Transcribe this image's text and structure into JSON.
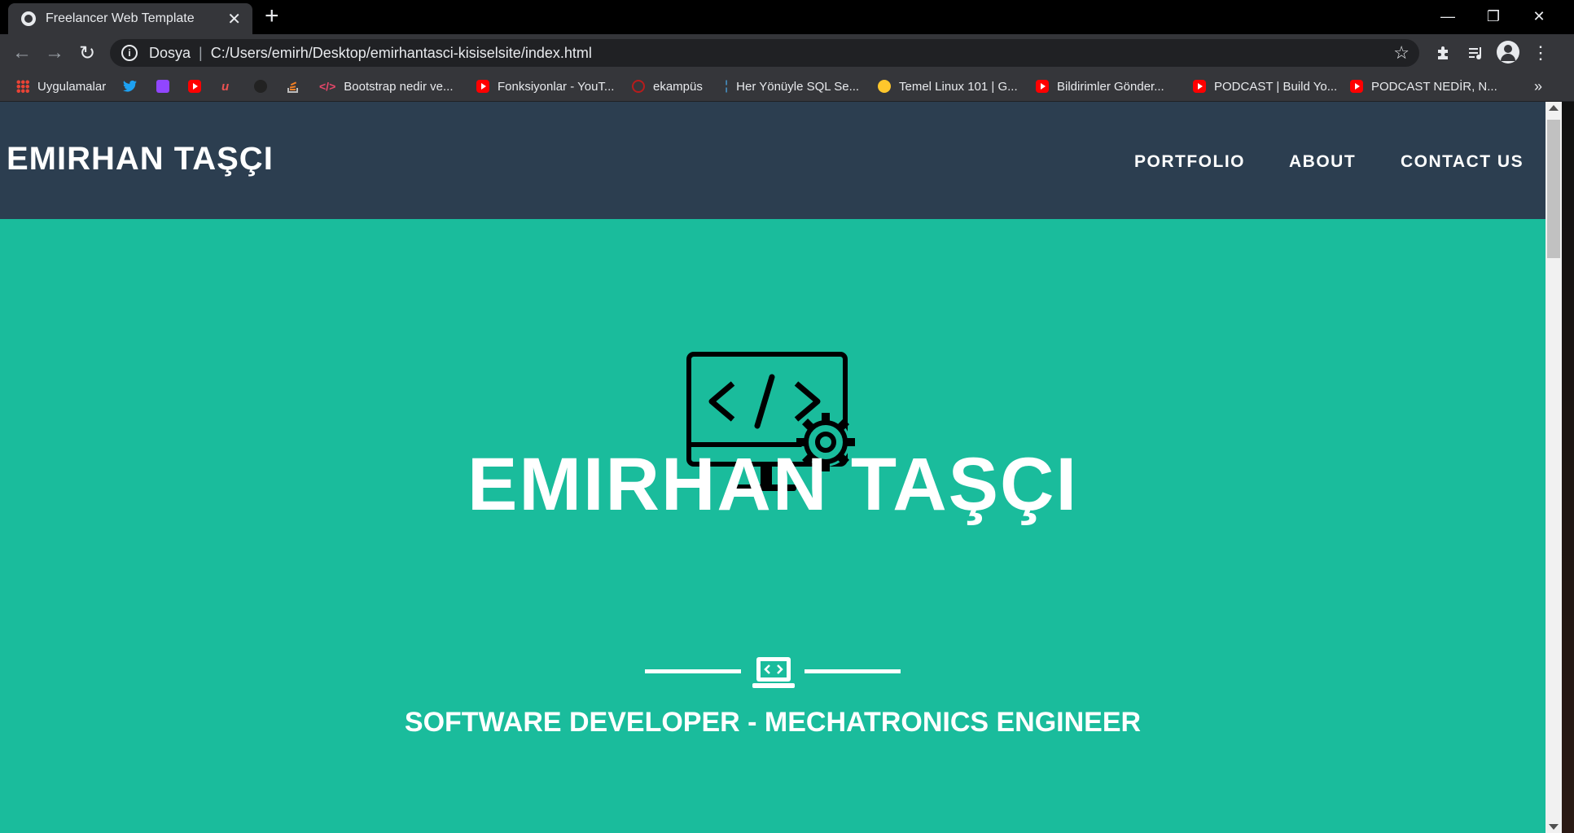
{
  "browser": {
    "tab_title": "Freelancer Web Template",
    "new_tab": "+",
    "window_controls": {
      "minimize": "—",
      "restore": "❐",
      "close": "✕"
    },
    "omnibox": {
      "prefix": "Dosya",
      "url": "C:/Users/emirh/Desktop/emirhantasci-kisiselsite/index.html"
    },
    "bookmarks": [
      {
        "label": "Uygulamalar",
        "icon": "apps-grid-icon"
      },
      {
        "label": "",
        "icon": "twitter-icon"
      },
      {
        "label": "",
        "icon": "twitch-icon"
      },
      {
        "label": "",
        "icon": "youtube-icon"
      },
      {
        "label": "",
        "icon": "udemy-icon"
      },
      {
        "label": "",
        "icon": "github-icon"
      },
      {
        "label": "",
        "icon": "stackoverflow-icon"
      },
      {
        "label": "Bootstrap nedir ve...",
        "icon": "code-icon"
      },
      {
        "label": "Fonksiyonlar - YouT...",
        "icon": "youtube-icon"
      },
      {
        "label": "ekampüs",
        "icon": "ekampus-icon"
      },
      {
        "label": "Her Yönüyle SQL Se...",
        "icon": "sql-icon"
      },
      {
        "label": "Temel Linux 101 | G...",
        "icon": "turkcell-icon"
      },
      {
        "label": "Bildirimler Gönder...",
        "icon": "youtube-icon"
      },
      {
        "label": "PODCAST | Build Yo...",
        "icon": "youtube-icon"
      },
      {
        "label": "PODCAST NEDİR, N...",
        "icon": "youtube-icon"
      }
    ],
    "bookmarks_overflow": "»"
  },
  "site": {
    "brand": "EMIRHAN TAŞÇI",
    "nav": [
      "PORTFOLIO",
      "ABOUT",
      "CONTACT US"
    ],
    "hero_title": "EMIRHAN TAŞÇI",
    "hero_subtitle": "SOFTWARE DEVELOPER - MECHATRONICS ENGINEER",
    "hero_icon": "monitor-code-gear-icon",
    "divider_icon": "laptop-code-icon"
  },
  "colors": {
    "navbar": "#2c3e50",
    "hero": "#1abc9c",
    "text": "#ffffff"
  }
}
